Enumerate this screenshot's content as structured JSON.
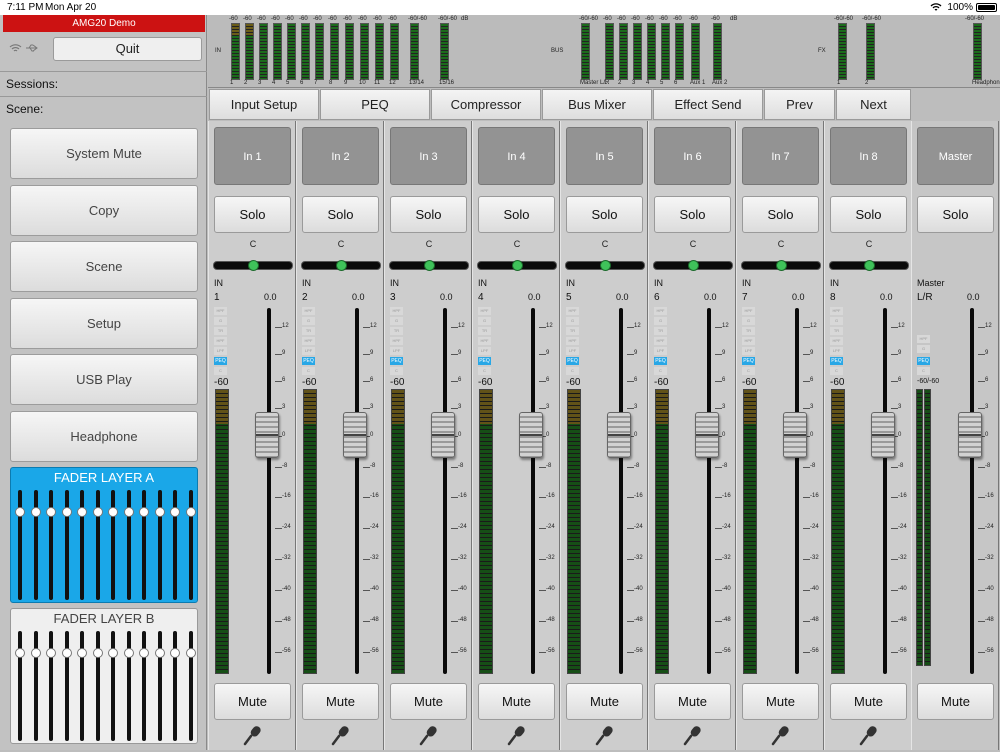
{
  "status": {
    "time": "7:11 PM",
    "date": "Mon Apr 20",
    "battery": "100%"
  },
  "app": {
    "title": "AMG20 Demo",
    "quit_label": "Quit"
  },
  "sidebar": {
    "sessions_label": "Sessions:",
    "scene_label": "Scene:",
    "buttons": [
      "System Mute",
      "Copy",
      "Scene",
      "Setup",
      "USB Play",
      "Headphone"
    ],
    "layer_a": "FADER LAYER A",
    "layer_b": "FADER LAYER B"
  },
  "meters": {
    "db_label": "dB",
    "in_label": "IN",
    "bus_label": "BUS",
    "fx_label": "FX",
    "scale_top": "-60",
    "scale_pair": "-60/-60",
    "in_channels": [
      "1",
      "2",
      "3",
      "4",
      "5",
      "6",
      "7",
      "8",
      "9",
      "10",
      "11",
      "12",
      "13/14",
      "15/16"
    ],
    "bus_channels": [
      "Master L/R",
      "1",
      "2",
      "3",
      "4",
      "5",
      "6",
      "Aux 1",
      "Aux 2"
    ],
    "fx_channels": [
      "1",
      "2"
    ],
    "headphone": "Headphone"
  },
  "tabs": [
    "Input Setup",
    "PEQ",
    "Compressor",
    "Bus Mixer",
    "Effect Send",
    "Prev",
    "Next"
  ],
  "channels": [
    {
      "name": "In 1",
      "num": "1"
    },
    {
      "name": "In 2",
      "num": "2"
    },
    {
      "name": "In 3",
      "num": "3"
    },
    {
      "name": "In 4",
      "num": "4"
    },
    {
      "name": "In 5",
      "num": "5"
    },
    {
      "name": "In 6",
      "num": "6"
    },
    {
      "name": "In 7",
      "num": "7"
    },
    {
      "name": "In 8",
      "num": "8"
    }
  ],
  "strip": {
    "solo": "Solo",
    "mute": "Mute",
    "pan": "C",
    "in": "IN",
    "gain": "0.0",
    "minus60": "-60",
    "proc": [
      "HPF",
      "G",
      "TR",
      "HPF",
      "LPF",
      "PEQ",
      "C"
    ],
    "scale": [
      "12",
      "9",
      "6",
      "3",
      "0",
      "-8",
      "-16",
      "-24",
      "-32",
      "-40",
      "-48",
      "-56"
    ]
  },
  "master": {
    "name": "Master",
    "solo": "Solo",
    "mute": "Mute",
    "label": "Master",
    "lr": "L/R",
    "gain": "0.0",
    "pair": "-60/-60",
    "proc": [
      "HPF",
      "G",
      "PEQ",
      "C"
    ]
  }
}
